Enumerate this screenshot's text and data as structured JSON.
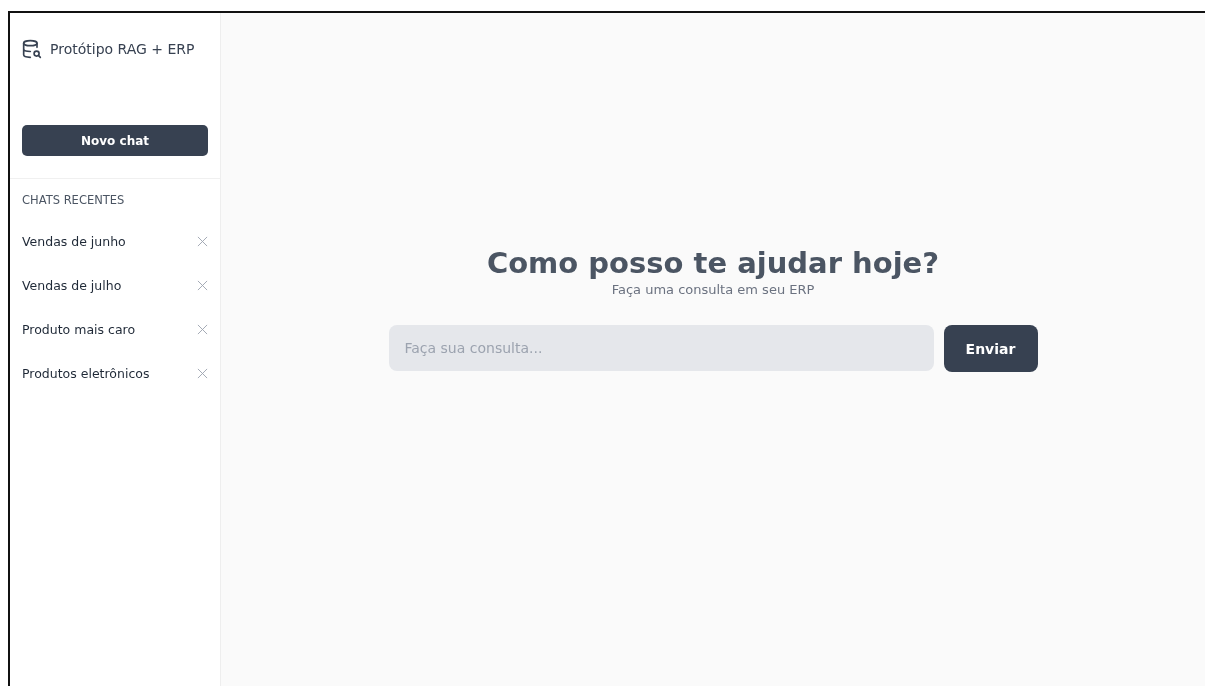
{
  "sidebar": {
    "title": "Protótipo RAG + ERP",
    "new_chat_button": "Novo chat",
    "section_title": "CHATS RECENTES",
    "chats": [
      {
        "label": "Vendas de junho"
      },
      {
        "label": "Vendas de julho"
      },
      {
        "label": "Produto mais caro"
      },
      {
        "label": "Produtos eletrônicos"
      }
    ]
  },
  "main": {
    "heading": "Como posso te ajudar hoje?",
    "subheading": "Faça uma consulta em seu ERP",
    "query_field": {
      "placeholder": "Faça sua consulta..."
    },
    "send_button": "Enviar"
  }
}
